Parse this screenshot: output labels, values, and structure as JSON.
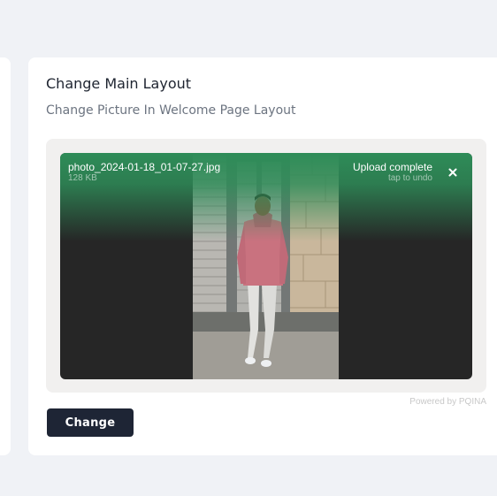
{
  "card": {
    "title": "Change Main Layout",
    "subtitle": "Change Picture In Welcome Page Layout"
  },
  "upload": {
    "file_name": "photo_2024-01-18_01-07-27.jpg",
    "file_size": "128 KB",
    "status": "Upload complete",
    "status_hint": "tap to undo",
    "close_icon": "close-icon",
    "success_color": "#2e8c58",
    "credits": "Powered by PQINA"
  },
  "actions": {
    "change_label": "Change"
  }
}
